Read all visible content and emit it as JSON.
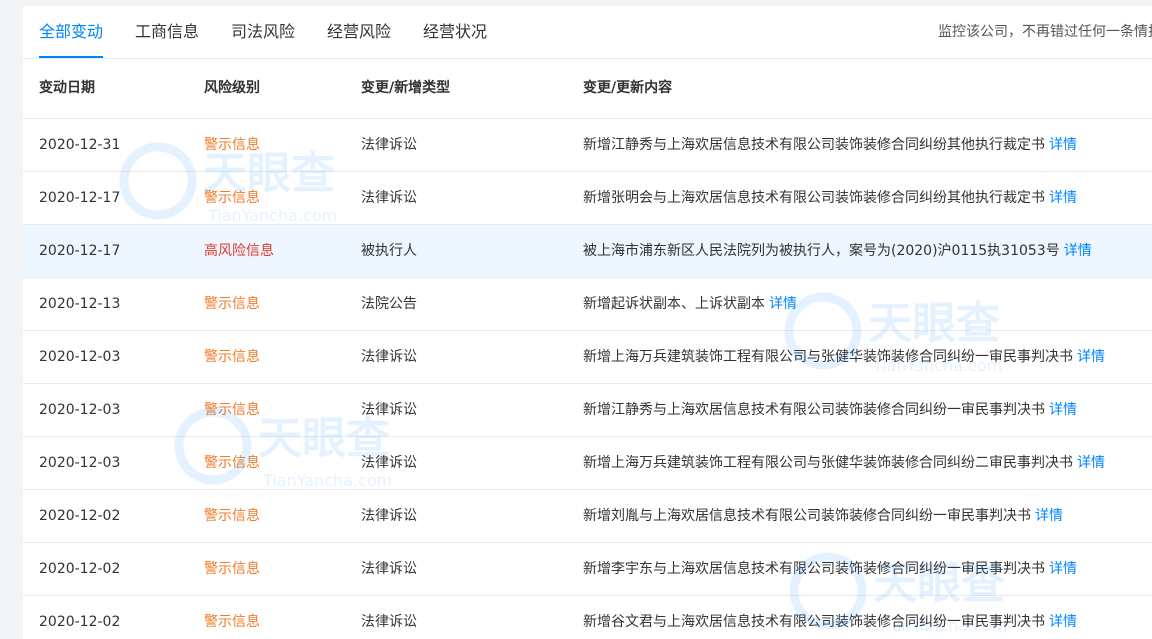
{
  "tabs": [
    "全部变动",
    "工商信息",
    "司法风险",
    "经营风险",
    "经营状况"
  ],
  "monitor_text": "监控该公司，不再错过任何一条情报",
  "columns": [
    "变动日期",
    "风险级别",
    "变更/新增类型",
    "变更/更新内容"
  ],
  "detail_label": "详情",
  "watermark": {
    "cn": "天眼查",
    "en": "TianYancha.com"
  },
  "colors": {
    "accent": "#0084ff",
    "warning": "#f07b28",
    "high_risk": "#e0392e",
    "highlight_row": "#eef6ff"
  },
  "rows": [
    {
      "date": "2020-12-31",
      "risk": "警示信息",
      "type": "法律诉讼",
      "content": "新增江静秀与上海欢居信息技术有限公司装饰装修合同纠纷其他执行裁定书"
    },
    {
      "date": "2020-12-17",
      "risk": "警示信息",
      "type": "法律诉讼",
      "content": "新增张明会与上海欢居信息技术有限公司装饰装修合同纠纷其他执行裁定书"
    },
    {
      "date": "2020-12-17",
      "risk": "高风险信息",
      "type": "被执行人",
      "content": "被上海市浦东新区人民法院列为被执行人，案号为(2020)沪0115执31053号"
    },
    {
      "date": "2020-12-13",
      "risk": "警示信息",
      "type": "法院公告",
      "content": "新增起诉状副本、上诉状副本"
    },
    {
      "date": "2020-12-03",
      "risk": "警示信息",
      "type": "法律诉讼",
      "content": "新增上海万兵建筑装饰工程有限公司与张健华装饰装修合同纠纷一审民事判决书"
    },
    {
      "date": "2020-12-03",
      "risk": "警示信息",
      "type": "法律诉讼",
      "content": "新增江静秀与上海欢居信息技术有限公司装饰装修合同纠纷一审民事判决书"
    },
    {
      "date": "2020-12-03",
      "risk": "警示信息",
      "type": "法律诉讼",
      "content": "新增上海万兵建筑装饰工程有限公司与张健华装饰装修合同纠纷二审民事判决书"
    },
    {
      "date": "2020-12-02",
      "risk": "警示信息",
      "type": "法律诉讼",
      "content": "新增刘胤与上海欢居信息技术有限公司装饰装修合同纠纷一审民事判决书"
    },
    {
      "date": "2020-12-02",
      "risk": "警示信息",
      "type": "法律诉讼",
      "content": "新增李宇东与上海欢居信息技术有限公司装饰装修合同纠纷一审民事判决书"
    },
    {
      "date": "2020-12-02",
      "risk": "警示信息",
      "type": "法律诉讼",
      "content": "新增谷文君与上海欢居信息技术有限公司装饰装修合同纠纷一审民事判决书"
    }
  ]
}
